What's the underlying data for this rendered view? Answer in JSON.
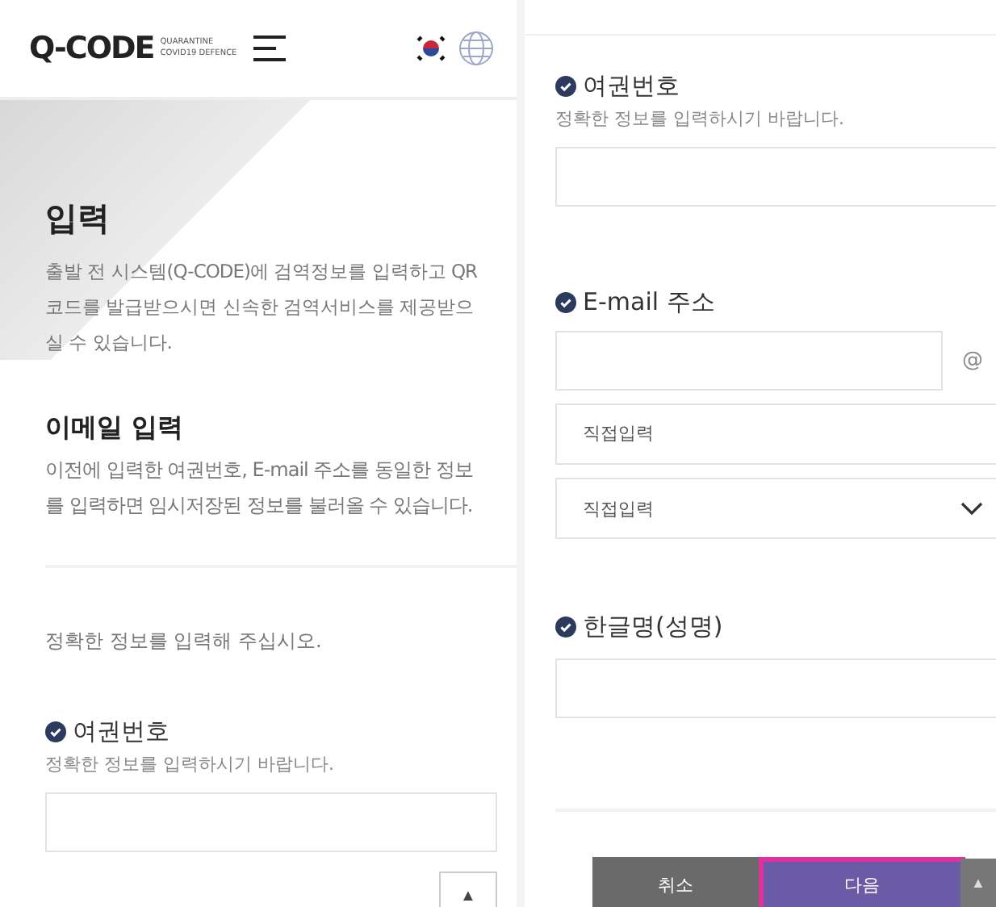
{
  "left_panel": {
    "header": {
      "logo": "Q-CODE",
      "tagline": [
        "QUARANTINE",
        "COVID19 DEFENCE"
      ]
    },
    "intro": {
      "title": "입력",
      "description": "출발 전 시스템(Q-CODE)에 검역정보를 입력하고 QR코드를 발급받으시면 신속한 검역서비스를 제공받으실 수 있습니다."
    },
    "email_section": {
      "title": "이메일 입력",
      "description": "이전에 입력한 여권번호, E-mail 주소를 동일한 정보를 입력하면 임시저장된 정보를 불러올 수 있습니다."
    },
    "notice": "정확한 정보를 입력해 주십시오.",
    "fields": [
      {
        "label": "여권번호",
        "hint": "정확한 정보를 입력하시기 바랍니다."
      }
    ],
    "scroll_top_button": "▲"
  },
  "right_panel": {
    "fields": [
      {
        "kind": "text",
        "label": "여권번호",
        "hint": "정확한 정보를 입력하시기 바랍니다."
      },
      {
        "kind": "email",
        "label": "E-mail 주소",
        "at": "@",
        "domain_input": {
          "placeholder": "직접입력"
        },
        "domain_select": {
          "value": "직접입력"
        }
      },
      {
        "kind": "text",
        "label": "한글명(성명)"
      }
    ],
    "buttons": [
      {
        "label": "취소",
        "kind": "secondary",
        "highlighted": false
      },
      {
        "label": "다음",
        "kind": "primary",
        "highlighted": true
      }
    ],
    "scroll_top_button": "▲"
  }
}
